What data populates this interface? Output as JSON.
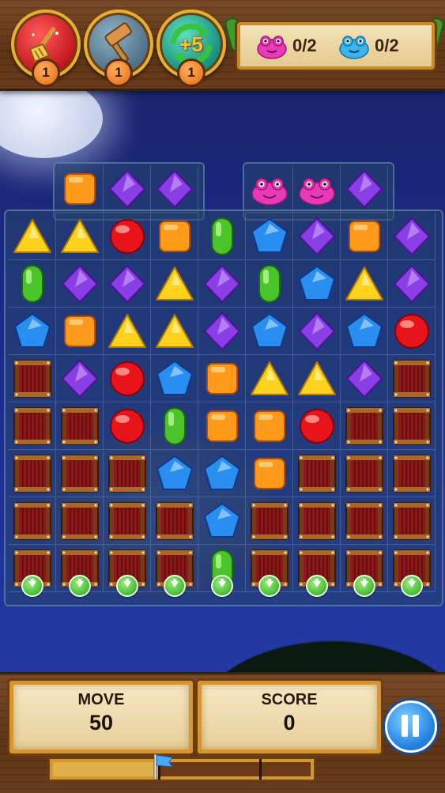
{
  "boosters": [
    {
      "name": "broom",
      "count": "1"
    },
    {
      "name": "hammer",
      "count": "1"
    },
    {
      "name": "extra-moves",
      "label": "+5",
      "count": "1"
    }
  ],
  "goals": [
    {
      "monster": "pink",
      "progress": "0/2"
    },
    {
      "monster": "blue",
      "progress": "0/2"
    }
  ],
  "board": {
    "rows": [
      [
        "",
        "orange-square",
        "purple-diamond",
        "purple-diamond",
        "",
        "pink-monster",
        "pink-monster",
        "purple-diamond",
        ""
      ],
      [
        "yellow-triangle",
        "yellow-triangle",
        "red-orb",
        "orange-square",
        "green-capsule",
        "blue-pentagon",
        "purple-diamond",
        "orange-square",
        "purple-diamond"
      ],
      [
        "green-capsule",
        "purple-diamond",
        "purple-diamond",
        "yellow-triangle",
        "purple-diamond",
        "green-capsule",
        "blue-pentagon",
        "yellow-triangle",
        "purple-diamond"
      ],
      [
        "blue-pentagon",
        "orange-square",
        "yellow-triangle",
        "yellow-triangle",
        "purple-diamond",
        "blue-pentagon",
        "purple-diamond",
        "blue-pentagon",
        "red-orb"
      ],
      [
        "crate",
        "purple-diamond",
        "red-orb",
        "blue-pentagon",
        "orange-square",
        "yellow-triangle",
        "yellow-triangle",
        "purple-diamond",
        "crate"
      ],
      [
        "crate",
        "crate",
        "red-orb",
        "green-capsule",
        "orange-square",
        "orange-square",
        "red-orb",
        "crate",
        "crate"
      ],
      [
        "crate",
        "crate",
        "crate",
        "blue-pentagon",
        "blue-pentagon",
        "orange-square",
        "crate",
        "crate",
        "crate"
      ],
      [
        "crate",
        "crate",
        "crate",
        "crate",
        "blue-pentagon",
        "crate",
        "crate",
        "crate",
        "crate"
      ],
      [
        "crate",
        "crate",
        "crate",
        "crate",
        "green-capsule",
        "crate",
        "crate",
        "crate",
        "crate"
      ]
    ],
    "drop_arrows": 9
  },
  "moves": {
    "label": "MOVE",
    "value": "50"
  },
  "score": {
    "label": "SCORE",
    "value": "0"
  },
  "progress": {
    "fraction": 0.41
  },
  "colors": {
    "wood": "#6b3d1c",
    "parchment": "#f5e3b8",
    "gold_frame": "#d7962c",
    "pause_blue": "#1f7ce0"
  }
}
